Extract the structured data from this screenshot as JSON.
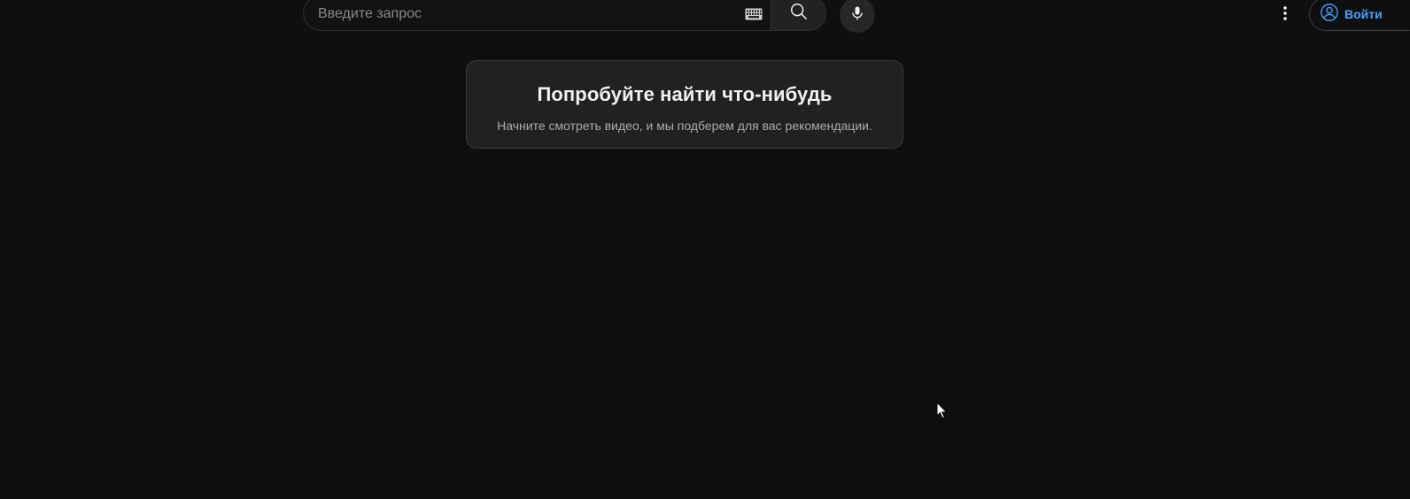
{
  "header": {
    "search": {
      "placeholder": "Введите запрос",
      "value": "",
      "keyboard_icon": "keyboard-icon",
      "search_icon": "search-icon"
    },
    "mic_icon": "microphone-icon",
    "more_icon": "more-vertical-icon",
    "signin": {
      "label": "Войти",
      "icon": "account-circle-icon"
    }
  },
  "empty_state": {
    "title": "Попробуйте найти что-нибудь",
    "subtitle": "Начните смотреть видео, и мы подберем для вас рекомендации."
  },
  "colors": {
    "background": "#0f0f0f",
    "card": "#212121",
    "accent": "#3ea6ff",
    "text_primary": "#f1f1f1",
    "text_secondary": "#aaaaaa"
  }
}
